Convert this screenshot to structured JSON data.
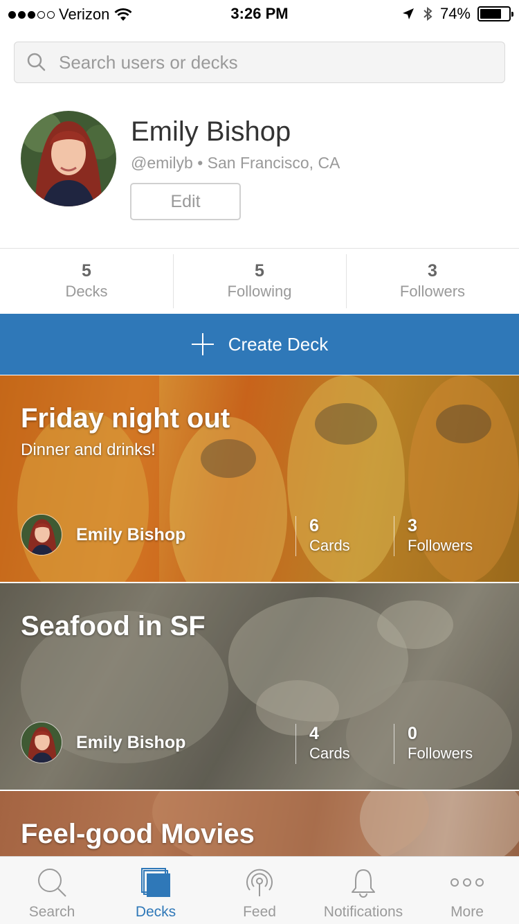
{
  "status_bar": {
    "carrier": "Verizon",
    "time": "3:26 PM",
    "battery": "74%",
    "battery_level": 0.74,
    "signal_bars": 3,
    "icons": [
      "wifi-icon",
      "location-arrow-icon",
      "bluetooth-icon",
      "battery-icon"
    ]
  },
  "search": {
    "placeholder": "Search users or decks",
    "value": ""
  },
  "profile": {
    "name": "Emily Bishop",
    "handle": "@emilyb",
    "separator": "•",
    "location": "San Francisco, CA",
    "edit_label": "Edit"
  },
  "stats": [
    {
      "value": "5",
      "label": "Decks"
    },
    {
      "value": "5",
      "label": "Following"
    },
    {
      "value": "3",
      "label": "Followers"
    }
  ],
  "create_deck": {
    "label": "Create Deck",
    "color": "#2f78b8"
  },
  "decks": [
    {
      "title": "Friday night out",
      "description": "Dinner and drinks!",
      "owner": "Emily Bishop",
      "cards_count": "6",
      "cards_label": "Cards",
      "followers_count": "3",
      "followers_label": "Followers"
    },
    {
      "title": "Seafood in SF",
      "owner": "Emily Bishop",
      "cards_count": "4",
      "cards_label": "Cards",
      "followers_count": "0",
      "followers_label": "Followers"
    },
    {
      "title": "Feel-good Movies"
    }
  ],
  "tab_bar": {
    "active": "Decks",
    "active_color": "#2f78b8",
    "tabs": [
      {
        "label": "Search",
        "icon": "search-icon"
      },
      {
        "label": "Decks",
        "icon": "decks-icon"
      },
      {
        "label": "Feed",
        "icon": "broadcast-icon"
      },
      {
        "label": "Notifications",
        "icon": "bell-icon"
      },
      {
        "label": "More",
        "icon": "more-dots-icon"
      }
    ]
  }
}
